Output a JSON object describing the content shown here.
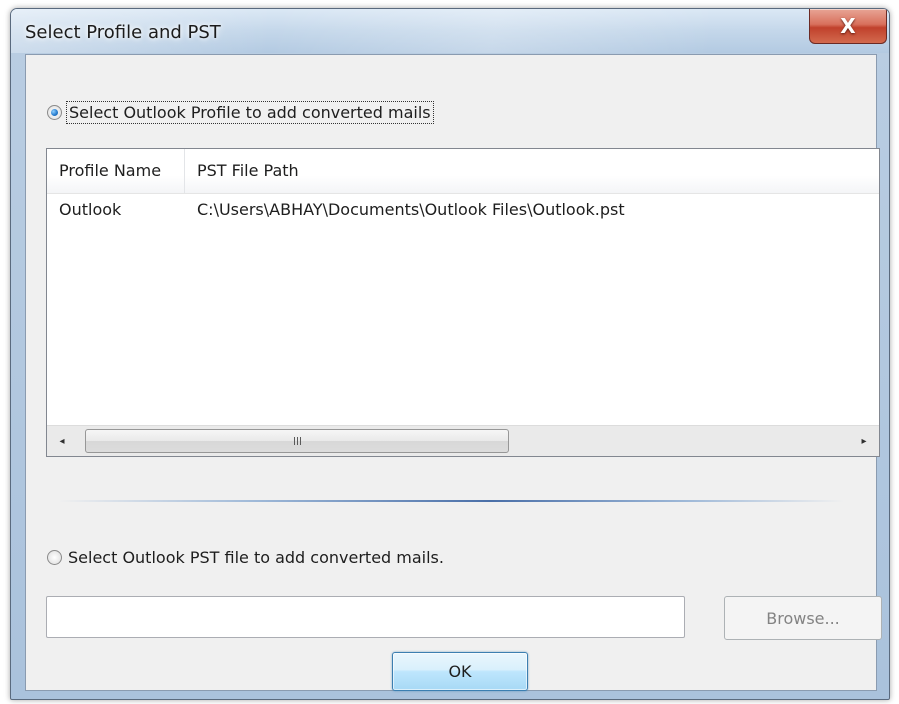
{
  "window": {
    "title": "Select Profile and PST",
    "close_label": "X"
  },
  "profile_option": {
    "label": "Select Outlook Profile to add converted mails",
    "checked": true
  },
  "profile_list": {
    "columns": [
      "Profile Name",
      "PST File Path"
    ],
    "rows": [
      {
        "profile_name": "Outlook",
        "pst_file_path": "C:\\Users\\ABHAY\\Documents\\Outlook Files\\Outlook.pst"
      }
    ]
  },
  "scrollbar": {
    "left_arrow": "◂",
    "right_arrow": "▸"
  },
  "pst_option": {
    "label": "Select Outlook PST file to add converted mails.",
    "checked": false
  },
  "pst_path": {
    "value": "",
    "placeholder": ""
  },
  "buttons": {
    "browse_label": "Browse...",
    "ok_label": "OK"
  },
  "colors": {
    "close_button": "#c0412c",
    "ok_border": "#3c7fb1",
    "radio_selected": "#2a7fd0"
  }
}
